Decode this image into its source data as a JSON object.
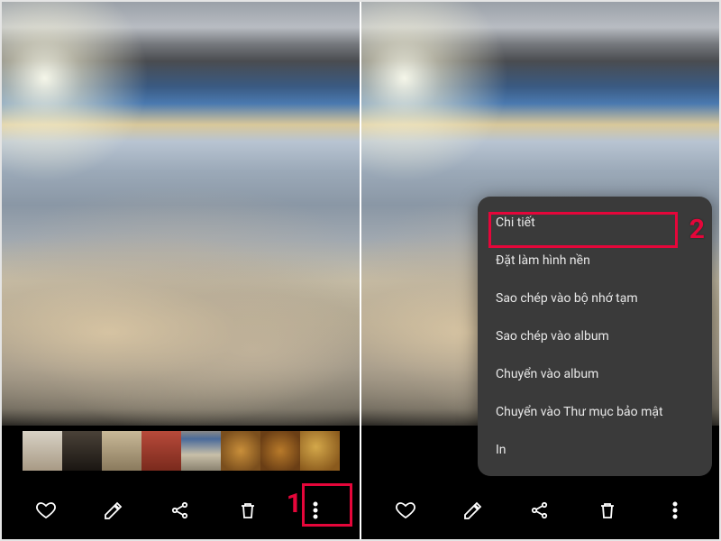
{
  "left_panel": {
    "toolbar": {
      "favorite": "favorite",
      "edit": "edit",
      "share": "share",
      "delete": "delete",
      "more": "more"
    },
    "step1_label": "1"
  },
  "right_panel": {
    "menu_items": [
      "Chi tiết",
      "Đặt làm hình nền",
      "Sao chép vào bộ nhớ tạm",
      "Sao chép vào album",
      "Chuyển vào album",
      "Chuyển vào Thư mục bảo mật",
      "In"
    ],
    "step2_label": "2",
    "toolbar": {
      "favorite": "favorite",
      "edit": "edit",
      "share": "share",
      "delete": "delete",
      "more": "more"
    }
  }
}
